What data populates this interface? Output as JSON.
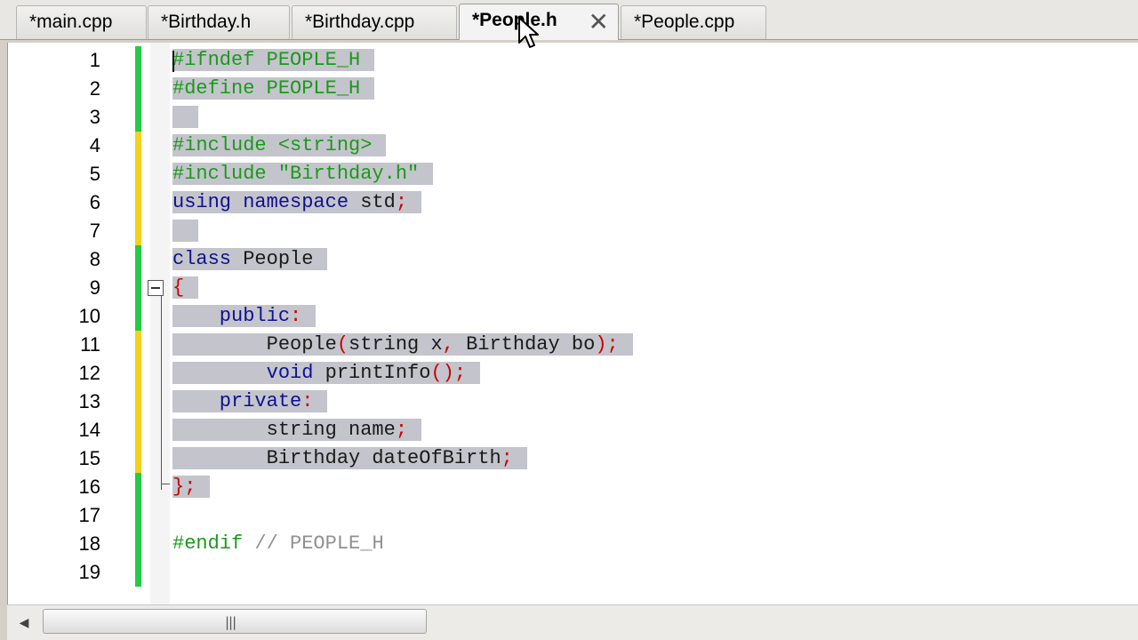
{
  "tabs": [
    {
      "label": "*main.cpp",
      "active": false
    },
    {
      "label": "*Birthday.h",
      "active": false
    },
    {
      "label": "*Birthday.cpp",
      "active": false
    },
    {
      "label": "*People.h",
      "active": true,
      "close_glyph": "✕"
    },
    {
      "label": "*People.cpp",
      "active": false
    }
  ],
  "editor": {
    "line_numbers": [
      "1",
      "2",
      "3",
      "4",
      "5",
      "6",
      "7",
      "8",
      "9",
      "10",
      "11",
      "12",
      "13",
      "14",
      "15",
      "16",
      "17",
      "18",
      "19"
    ],
    "change_markers": [
      "green",
      "green",
      "green",
      "yellow",
      "yellow",
      "yellow",
      "yellow",
      "green",
      "green",
      "green",
      "yellow",
      "yellow",
      "yellow",
      "yellow",
      "yellow",
      "green",
      "green",
      "green",
      "green"
    ],
    "code_lines": [
      [
        {
          "t": "pp",
          "v": "#ifndef PEOPLE_H"
        }
      ],
      [
        {
          "t": "pp",
          "v": "#define PEOPLE_H"
        }
      ],
      [
        {
          "t": "id",
          "v": ""
        }
      ],
      [
        {
          "t": "pp",
          "v": "#include <string>"
        }
      ],
      [
        {
          "t": "pp",
          "v": "#include \"Birthday.h\""
        }
      ],
      [
        {
          "t": "kw",
          "v": "using namespace "
        },
        {
          "t": "id",
          "v": "std"
        },
        {
          "t": "op",
          "v": ";"
        }
      ],
      [
        {
          "t": "id",
          "v": ""
        }
      ],
      [
        {
          "t": "kw",
          "v": "class "
        },
        {
          "t": "id",
          "v": "People"
        }
      ],
      [
        {
          "t": "op",
          "v": "{"
        }
      ],
      [
        {
          "t": "kw",
          "v": "    public"
        },
        {
          "t": "op",
          "v": ":"
        }
      ],
      [
        {
          "t": "id",
          "v": "        People"
        },
        {
          "t": "op",
          "v": "("
        },
        {
          "t": "id",
          "v": "string x"
        },
        {
          "t": "op",
          "v": ", "
        },
        {
          "t": "id",
          "v": "Birthday bo"
        },
        {
          "t": "op",
          "v": ");"
        }
      ],
      [
        {
          "t": "kw",
          "v": "        void "
        },
        {
          "t": "id",
          "v": "printInfo"
        },
        {
          "t": "op",
          "v": "();"
        }
      ],
      [
        {
          "t": "kw",
          "v": "    private"
        },
        {
          "t": "op",
          "v": ":"
        }
      ],
      [
        {
          "t": "id",
          "v": "        string name"
        },
        {
          "t": "op",
          "v": ";"
        }
      ],
      [
        {
          "t": "id",
          "v": "        Birthday dateOfBirth"
        },
        {
          "t": "op",
          "v": ";"
        }
      ],
      [
        {
          "t": "op",
          "v": "};"
        }
      ],
      [
        {
          "t": "id",
          "v": ""
        }
      ],
      [
        {
          "t": "pp",
          "v": "#endif "
        },
        {
          "t": "cm",
          "v": "// PEOPLE_H"
        }
      ],
      [
        {
          "t": "id",
          "v": ""
        }
      ]
    ],
    "selected_lines": 16
  },
  "scrollbar": {
    "left_arrow": "◀",
    "grip": "|||"
  },
  "colors": {
    "change_green": "#22cc44",
    "change_yellow": "#f2d21b",
    "selection": "#c4c4cc"
  }
}
